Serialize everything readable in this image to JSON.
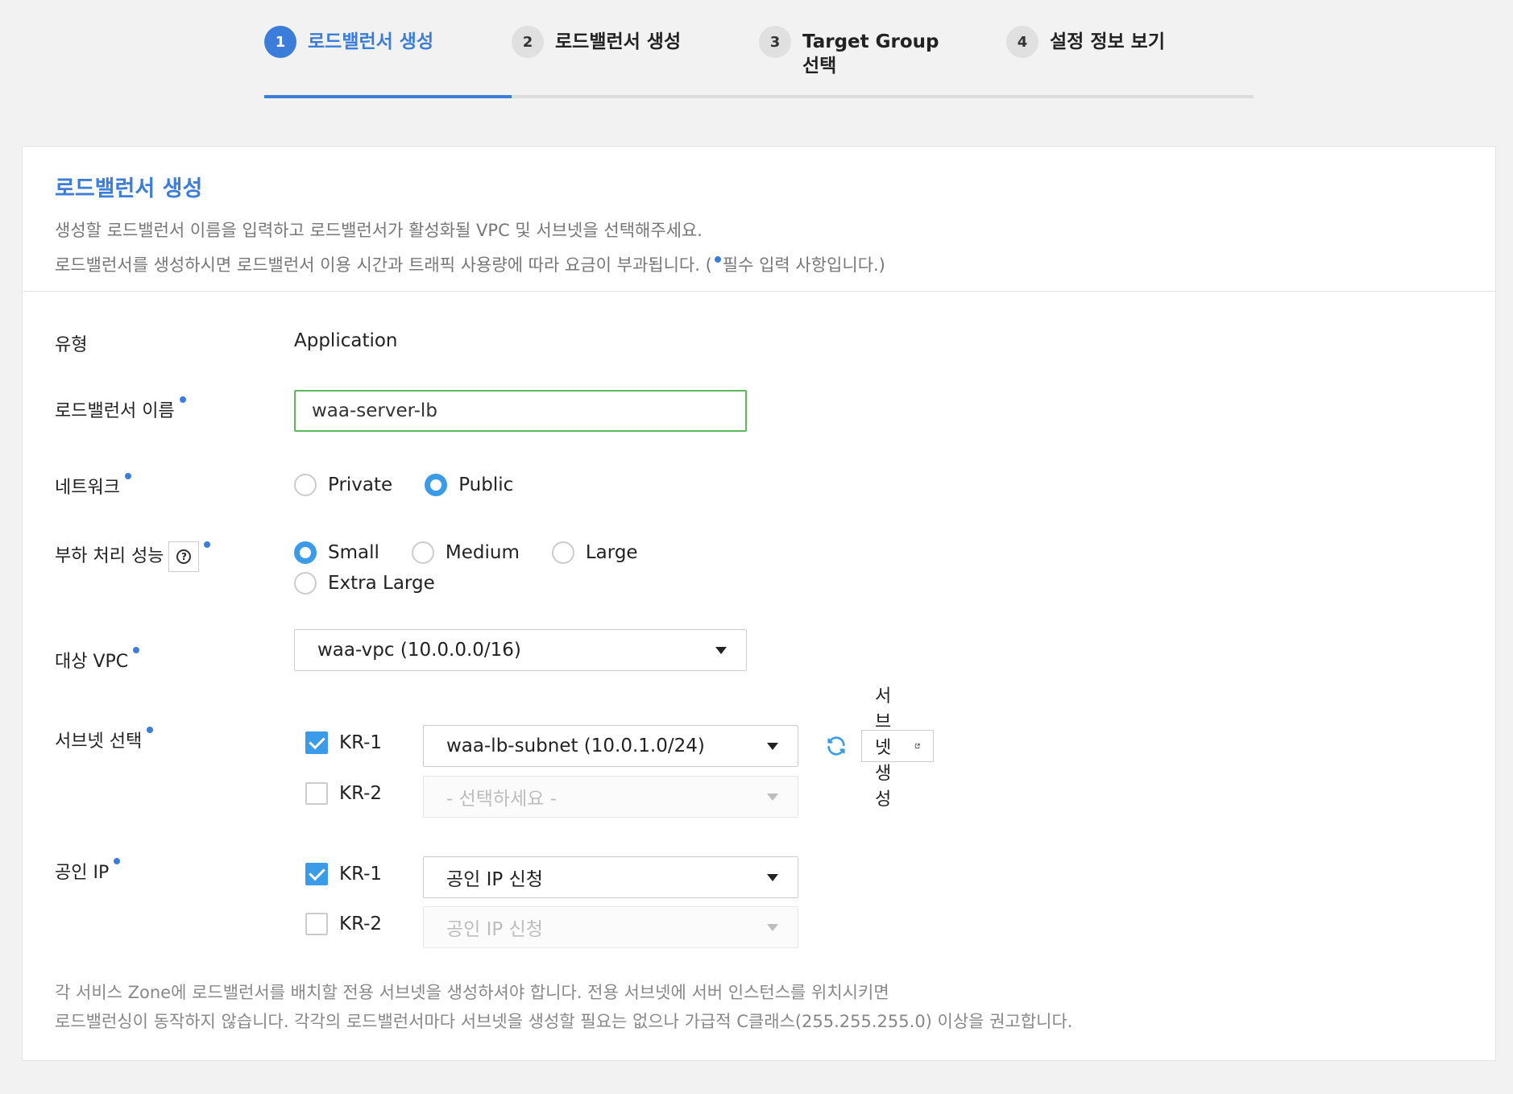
{
  "steps": [
    {
      "num": "1",
      "label": "로드밸런서 생성"
    },
    {
      "num": "2",
      "label": "로드밸런서 생성"
    },
    {
      "num": "3",
      "label": "Target Group 선택"
    },
    {
      "num": "4",
      "label": "설정 정보 보기"
    }
  ],
  "step_progress": 0.25,
  "panel": {
    "title": "로드밸런서 생성",
    "desc1": "생성할 로드밸런서 이름을 입력하고 로드밸런서가 활성화될 VPC 및 서브넷을 선택해주세요.",
    "desc2_pre": "로드밸런서를 생성하시면 로드밸런서 이용 시간과 트래픽 사용량에 따라 요금이 부과됩니다. (",
    "desc2_post": "필수 입력 사항입니다.)"
  },
  "form": {
    "type_label": "유형",
    "type_value": "Application",
    "name_label": "로드밸런서 이름",
    "name_value": "waa-server-lb",
    "network_label": "네트워크",
    "network_options": [
      "Private",
      "Public"
    ],
    "network_selected": "Public",
    "perf_label": "부하 처리 성능",
    "perf_options": [
      "Small",
      "Medium",
      "Large",
      "Extra Large"
    ],
    "perf_selected": "Small",
    "vpc_label": "대상 VPC",
    "vpc_value": "waa-vpc (10.0.0.0/16)",
    "subnet_label": "서브넷 선택",
    "subnet_rows": [
      {
        "zone": "KR-1",
        "checked": true,
        "value": "waa-lb-subnet (10.0.1.0/24)"
      },
      {
        "zone": "KR-2",
        "checked": false,
        "value": "- 선택하세요 -"
      }
    ],
    "subnet_create_label": "서브넷 생성",
    "public_ip_label": "공인 IP",
    "public_ip_rows": [
      {
        "zone": "KR-1",
        "checked": true,
        "value": "공인 IP 신청"
      },
      {
        "zone": "KR-2",
        "checked": false,
        "value": "공인 IP 신청"
      }
    ]
  },
  "footnote": {
    "line1": "각 서비스 Zone에 로드밸런서를 배치할 전용 서브넷을 생성하셔야 합니다. 전용 서브넷에 서버 인스턴스를 위치시키면",
    "line2": "로드밸런싱이 동작하지 않습니다. 각각의 로드밸런서마다 서브넷을 생성할 필요는 없으나 가급적 C클래스(255.255.255.0) 이상을 권고합니다."
  },
  "colors": {
    "accent": "#3b7dd8",
    "radio": "#3b9be8",
    "input_valid": "#5cb85c"
  }
}
